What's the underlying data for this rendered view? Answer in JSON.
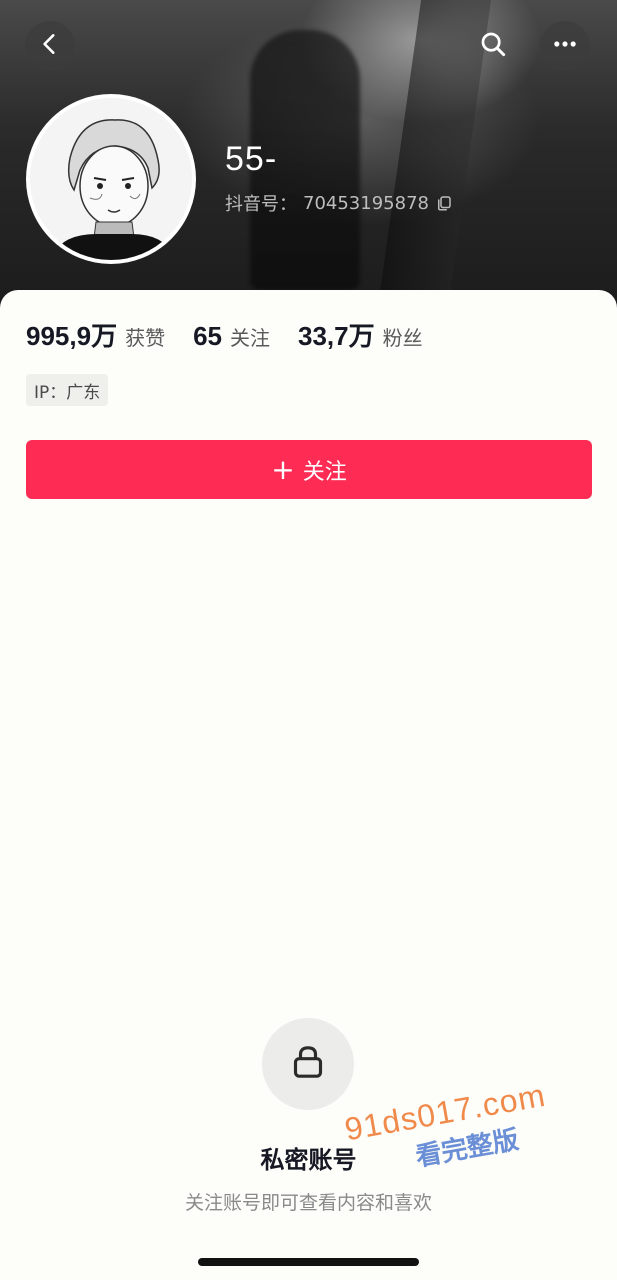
{
  "header": {
    "nickname": "55-",
    "douyin_id_label": "抖音号：",
    "douyin_id": "70453195878",
    "icons": {
      "back": "chevron-left-icon",
      "search": "search-icon",
      "more": "more-horizontal-icon",
      "copy": "copy-icon"
    }
  },
  "stats": [
    {
      "value": "995,9万",
      "label": "获赞"
    },
    {
      "value": "65",
      "label": "关注"
    },
    {
      "value": "33,7万",
      "label": "粉丝"
    }
  ],
  "ip_tag": "IP：广东",
  "follow_button": {
    "plus": "+",
    "label": "关注",
    "color": "#fe2c55"
  },
  "private_account": {
    "icon": "lock-icon",
    "title": "私密账号",
    "description": "关注账号即可查看内容和喜欢"
  },
  "watermark": {
    "url": "91ds017.com",
    "text": "看完整版"
  }
}
